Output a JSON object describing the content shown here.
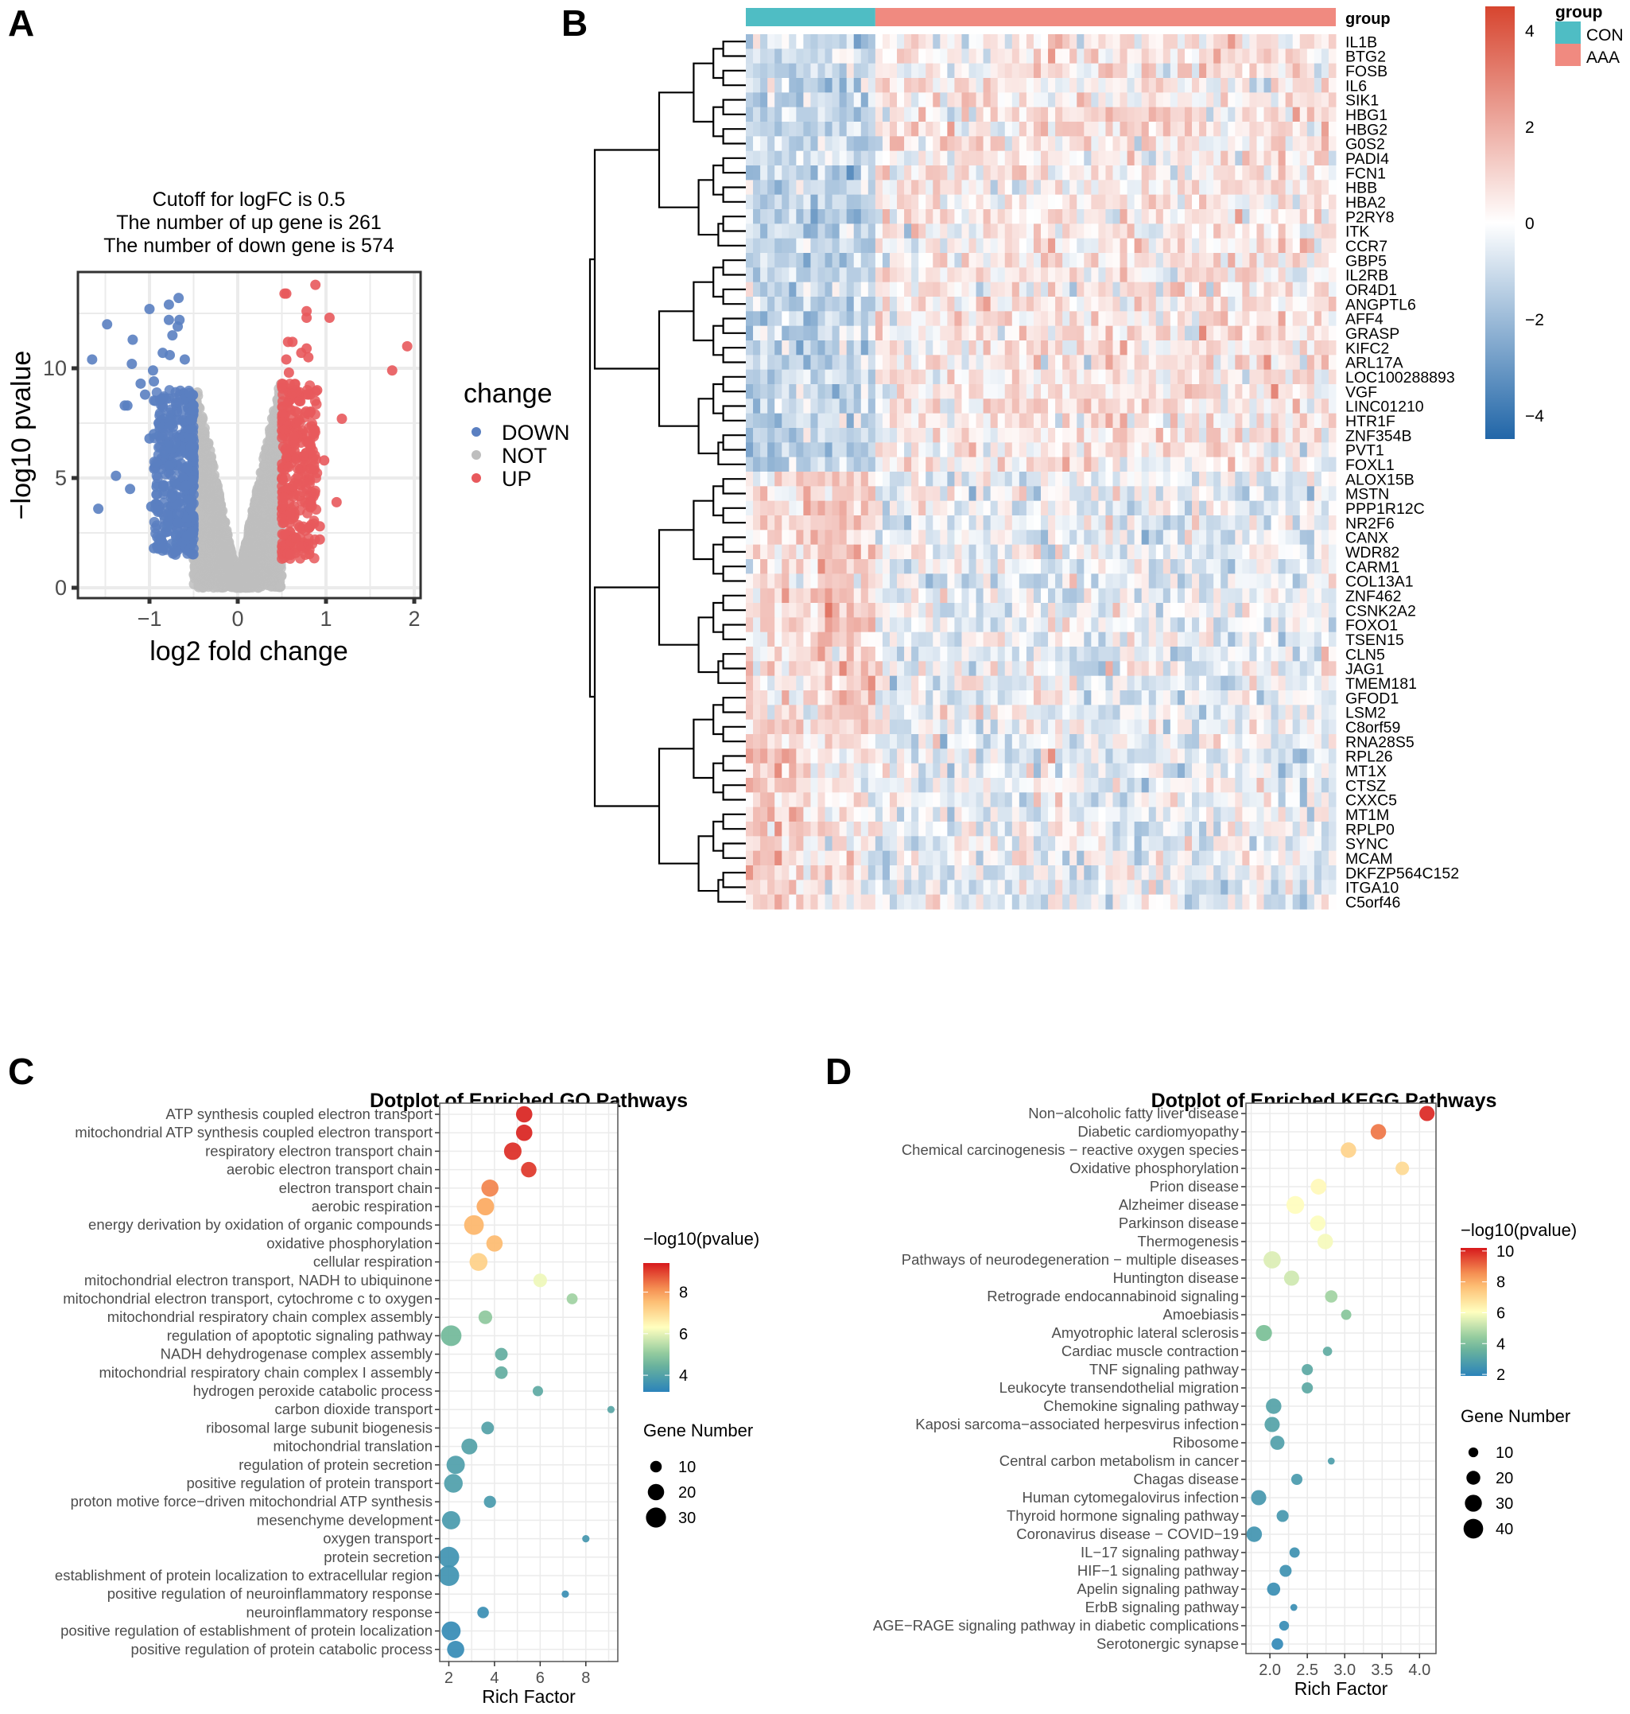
{
  "panel_letters": [
    "A",
    "B",
    "C",
    "D"
  ],
  "chart_data": [
    {
      "id": "A",
      "type": "scatter",
      "title_lines": [
        "Cutoff for logFC is 0.5",
        "The number of up gene is 261",
        "The number of down gene is 574"
      ],
      "xlabel": "log2 fold change",
      "ylabel": "−log10 pvalue",
      "xlim": [
        -1.8,
        2.0
      ],
      "ylim": [
        -0.3,
        14.0
      ],
      "xticks": [
        -1,
        0,
        1,
        2
      ],
      "xtick_labels": [
        "−1",
        "0",
        "1",
        "2"
      ],
      "yticks": [
        0,
        5,
        10
      ],
      "ytick_labels": [
        "0",
        "5",
        "10"
      ],
      "grid": true,
      "logfc_cutoff": 0.5,
      "up_count": 261,
      "down_count": 574,
      "legend": {
        "title": "change",
        "position": "right",
        "entries": [
          {
            "label": "DOWN",
            "color": "#5A7FC1"
          },
          {
            "label": "NOT",
            "color": "#BEBEBE"
          },
          {
            "label": "UP",
            "color": "#E8595C"
          }
        ]
      },
      "highlight_points": {
        "DOWN": [
          [
            -1.65,
            10.4
          ],
          [
            -1.48,
            12.0
          ],
          [
            -1.58,
            3.6
          ],
          [
            -1.38,
            5.1
          ],
          [
            -1.22,
            4.5
          ],
          [
            -1.25,
            8.3
          ],
          [
            -1.19,
            11.3
          ],
          [
            -1.2,
            10.2
          ],
          [
            -1.0,
            12.7
          ],
          [
            -0.78,
            12.9
          ],
          [
            -0.67,
            13.2
          ],
          [
            -0.78,
            12.2
          ],
          [
            -0.66,
            12.2
          ],
          [
            -0.68,
            11.9
          ],
          [
            -0.74,
            11.5
          ],
          [
            -0.96,
            9.9
          ],
          [
            -0.85,
            10.7
          ],
          [
            -0.77,
            10.6
          ],
          [
            -1.1,
            9.3
          ],
          [
            -0.95,
            9.4
          ],
          [
            -0.6,
            10.4
          ],
          [
            -1.05,
            8.8
          ],
          [
            -1.28,
            8.3
          ],
          [
            -0.95,
            7.0
          ],
          [
            -1.0,
            6.8
          ],
          [
            -0.92,
            4.6
          ],
          [
            -0.98,
            3.7
          ],
          [
            -0.95,
            1.8
          ],
          [
            -0.85,
            1.8
          ],
          [
            -0.75,
            2.0
          ],
          [
            -0.8,
            2.8
          ],
          [
            -0.7,
            2.4
          ]
        ],
        "UP": [
          [
            0.88,
            13.8
          ],
          [
            0.55,
            13.4
          ],
          [
            0.53,
            13.4
          ],
          [
            0.78,
            12.6
          ],
          [
            0.78,
            12.3
          ],
          [
            1.04,
            12.3
          ],
          [
            1.92,
            11.0
          ],
          [
            1.75,
            9.9
          ],
          [
            1.18,
            7.7
          ],
          [
            0.98,
            5.8
          ],
          [
            1.12,
            3.9
          ],
          [
            0.93,
            2.8
          ],
          [
            0.93,
            2.2
          ],
          [
            0.57,
            11.2
          ],
          [
            0.62,
            11.2
          ],
          [
            0.72,
            10.7
          ],
          [
            0.78,
            10.9
          ],
          [
            0.8,
            10.5
          ],
          [
            0.55,
            10.4
          ],
          [
            0.58,
            9.8
          ],
          [
            0.9,
            9.0
          ],
          [
            0.8,
            8.8
          ],
          [
            0.7,
            8.5
          ],
          [
            0.82,
            8.0
          ],
          [
            0.66,
            7.5
          ],
          [
            0.86,
            7.0
          ],
          [
            0.75,
            6.0
          ],
          [
            0.78,
            4.5
          ],
          [
            0.83,
            3.9
          ],
          [
            0.6,
            1.5
          ],
          [
            0.72,
            1.9
          ],
          [
            0.8,
            2.0
          ]
        ]
      },
      "scatter_note": "Dense DOWN band at logFC -1.0 to -0.5, dense NOT cloud forming V-shape around 0, dense UP band at 0.5 to 1.0"
    },
    {
      "id": "B",
      "type": "heatmap",
      "annotation_title": "group",
      "groups": [
        {
          "label": "CON",
          "color": "#4FBDC4",
          "n_samples": 18
        },
        {
          "label": "AAA",
          "color": "#F08A80",
          "n_samples": 64
        }
      ],
      "colorbar": {
        "ticks": [
          4,
          2,
          0,
          -2,
          -4
        ],
        "tick_labels": [
          "4",
          "2",
          "0",
          "−2",
          "−4"
        ],
        "range": [
          -4.5,
          4.5
        ],
        "colors": {
          "high": "#D7452F",
          "mid": "#FFFFFF",
          "low": "#2166A8"
        }
      },
      "legend": {
        "title": "group",
        "entries": [
          {
            "label": "CON",
            "color": "#4FBDC4"
          },
          {
            "label": "AAA",
            "color": "#F08A80"
          }
        ]
      },
      "genes": [
        "IL1B",
        "BTG2",
        "FOSB",
        "IL6",
        "SIK1",
        "HBG1",
        "HBG2",
        "G0S2",
        "PADI4",
        "FCN1",
        "HBB",
        "HBA2",
        "P2RY8",
        "ITK",
        "CCR7",
        "GBP5",
        "IL2RB",
        "OR4D1",
        "ANGPTL6",
        "AFF4",
        "GRASP",
        "KIFC2",
        "ARL17A",
        "LOC100288893",
        "VGF",
        "LINC01210",
        "HTR1F",
        "ZNF354B",
        "PVT1",
        "FOXL1",
        "ALOX15B",
        "MSTN",
        "PPP1R12C",
        "NR2F6",
        "CANX",
        "WDR82",
        "CARM1",
        "COL13A1",
        "ZNF462",
        "CSNK2A2",
        "FOXO1",
        "TSEN15",
        "CLN5",
        "JAG1",
        "TMEM181",
        "GFOD1",
        "LSM2",
        "C8orf59",
        "RNA28S5",
        "RPL26",
        "MT1X",
        "CTSZ",
        "CXXC5",
        "MT1M",
        "RPLP0",
        "SYNC",
        "MCAM",
        "DKFZP564C152",
        "ITGA10",
        "C5orf46"
      ],
      "gene_clusters": [
        {
          "genes_from": 0,
          "genes_to": 29,
          "pattern": "low (blue) in CON, high (red) in AAA"
        },
        {
          "genes_from": 30,
          "genes_to": 59,
          "pattern": "high (red) in CON, low (blue) in AAA"
        }
      ]
    },
    {
      "id": "C",
      "type": "scatter",
      "subtype": "dotplot",
      "title": "Dotplot of Enriched GO Pathways",
      "xlabel": "Rich Factor",
      "ylabel": "",
      "xlim": [
        1.6,
        9.4
      ],
      "xticks": [
        2,
        4,
        6,
        8
      ],
      "xtick_labels": [
        "2",
        "4",
        "6",
        "8"
      ],
      "grid": true,
      "color_legend": {
        "title": "−log10(pvalue)",
        "ticks": [
          8,
          6,
          4
        ],
        "range": [
          3.2,
          9.4
        ],
        "position": "right"
      },
      "size_legend": {
        "title": "Gene Number",
        "values": [
          10,
          20,
          30
        ],
        "position": "right"
      },
      "categories": [
        "ATP synthesis coupled electron transport",
        "mitochondrial ATP synthesis coupled electron transport",
        "respiratory electron transport chain",
        "aerobic electron transport chain",
        "electron transport chain",
        "aerobic respiration",
        "energy derivation by oxidation of organic compounds",
        "oxidative phosphorylation",
        "cellular respiration",
        "mitochondrial electron transport, NADH to ubiquinone",
        "mitochondrial electron transport, cytochrome c to oxygen",
        "mitochondrial respiratory chain complex assembly",
        "regulation of apoptotic signaling pathway",
        "NADH dehydrogenase complex assembly",
        "mitochondrial respiratory chain complex I assembly",
        "hydrogen peroxide catabolic process",
        "carbon dioxide transport",
        "ribosomal large subunit biogenesis",
        "mitochondrial translation",
        "regulation of protein secretion",
        "positive regulation of protein transport",
        "proton motive force−driven mitochondrial ATP synthesis",
        "mesenchyme development",
        "oxygen transport",
        "protein secretion",
        "establishment of protein localization to extracellular region",
        "positive regulation of neuroinflammatory response",
        "neuroinflammatory response",
        "positive regulation of establishment of protein localization",
        "positive regulation of protein catabolic process"
      ],
      "rich_factor": [
        5.3,
        5.3,
        4.8,
        5.5,
        3.8,
        3.6,
        3.1,
        4.0,
        3.3,
        6.0,
        7.4,
        3.6,
        2.1,
        4.3,
        4.3,
        5.9,
        9.1,
        3.7,
        2.9,
        2.3,
        2.2,
        3.8,
        2.1,
        8.0,
        2.0,
        2.0,
        7.1,
        3.5,
        2.1,
        2.3
      ],
      "neg_log10_p": [
        9.3,
        9.3,
        9.2,
        9.1,
        8.3,
        7.9,
        7.7,
        7.6,
        7.2,
        6.1,
        5.2,
        5.0,
        4.6,
        4.3,
        4.3,
        4.2,
        4.1,
        4.0,
        4.0,
        3.9,
        3.9,
        3.8,
        3.8,
        3.7,
        3.6,
        3.6,
        3.5,
        3.5,
        3.4,
        3.4
      ],
      "gene_number": [
        20,
        20,
        23,
        18,
        22,
        23,
        29,
        20,
        24,
        14,
        9,
        14,
        32,
        12,
        12,
        8,
        4,
        12,
        19,
        25,
        26,
        11,
        25,
        4,
        32,
        32,
        4,
        10,
        27,
        22
      ]
    },
    {
      "id": "D",
      "type": "scatter",
      "subtype": "dotplot",
      "title": "Dotplot of Enriched KEGG Pathways",
      "xlabel": "Rich Factor",
      "ylabel": "",
      "xlim": [
        1.68,
        4.22
      ],
      "xticks": [
        2.0,
        2.5,
        3.0,
        3.5,
        4.0
      ],
      "xtick_labels": [
        "2.0",
        "2.5",
        "3.0",
        "3.5",
        "4.0"
      ],
      "grid": true,
      "color_legend": {
        "title": "−log10(pvalue)",
        "ticks": [
          10,
          8,
          6,
          4,
          2
        ],
        "range": [
          1.9,
          10.2
        ],
        "position": "right"
      },
      "size_legend": {
        "title": "Gene Number",
        "values": [
          10,
          20,
          30,
          40
        ],
        "position": "right"
      },
      "categories": [
        "Non−alcoholic fatty liver disease",
        "Diabetic cardiomyopathy",
        "Chemical carcinogenesis − reactive oxygen species",
        "Oxidative phosphorylation",
        "Prion disease",
        "Alzheimer disease",
        "Parkinson disease",
        "Thermogenesis",
        "Pathways of neurodegeneration − multiple diseases",
        "Huntington disease",
        "Retrograde endocannabinoid signaling",
        "Amoebiasis",
        "Amyotrophic lateral sclerosis",
        "Cardiac muscle contraction",
        "TNF signaling pathway",
        "Leukocyte transendothelial migration",
        "Chemokine signaling pathway",
        "Kaposi sarcoma−associated herpesvirus infection",
        "Ribosome",
        "Central carbon metabolism in cancer",
        "Chagas disease",
        "Human cytomegalovirus infection",
        "Thyroid hormone signaling pathway",
        "Coronavirus disease − COVID−19",
        "IL−17 signaling pathway",
        "HIF−1 signaling pathway",
        "Apelin signaling pathway",
        "ErbB signaling pathway",
        "AGE−RAGE signaling pathway in diabetic complications",
        "Serotonergic synapse"
      ],
      "rich_factor": [
        4.1,
        3.45,
        3.05,
        3.77,
        2.65,
        2.34,
        2.64,
        2.74,
        2.03,
        2.29,
        2.82,
        3.02,
        1.92,
        2.77,
        2.5,
        2.5,
        2.05,
        2.03,
        2.1,
        2.82,
        2.36,
        1.85,
        2.17,
        1.79,
        2.33,
        2.21,
        2.05,
        2.32,
        2.19,
        2.1
      ],
      "neg_log10_p": [
        10.0,
        8.9,
        7.2,
        7.0,
        6.2,
        6.1,
        6.0,
        5.9,
        5.5,
        5.3,
        4.6,
        4.2,
        4.0,
        3.3,
        3.2,
        3.2,
        3.0,
        3.0,
        2.9,
        2.8,
        2.7,
        2.6,
        2.6,
        2.5,
        2.4,
        2.4,
        2.3,
        2.3,
        2.2,
        2.1
      ],
      "gene_number": [
        24,
        25,
        25,
        19,
        26,
        33,
        25,
        25,
        31,
        24,
        16,
        11,
        27,
        9,
        13,
        13,
        25,
        24,
        21,
        5,
        13,
        24,
        15,
        25,
        11,
        15,
        18,
        5,
        10,
        14
      ]
    }
  ]
}
